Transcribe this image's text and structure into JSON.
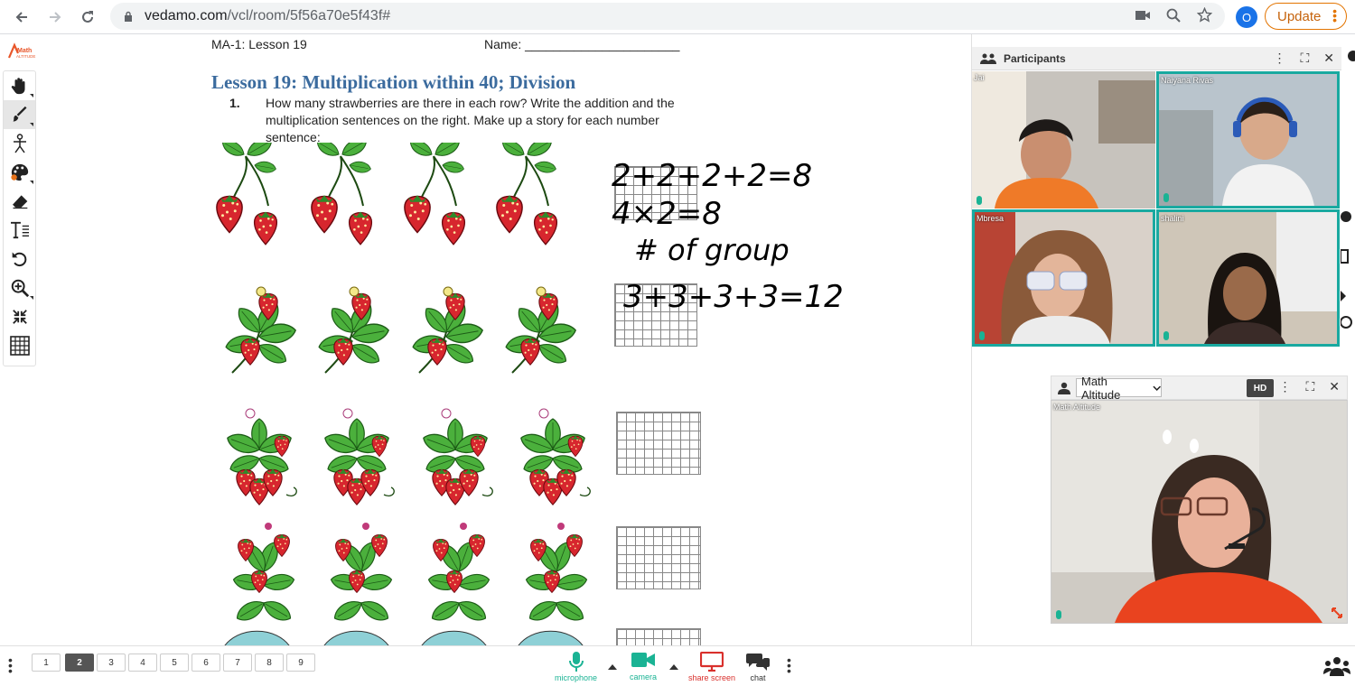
{
  "browser": {
    "url_host": "vedamo.com",
    "url_path": "/vcl/room/5f56a70e5f43f#",
    "profile_initial": "O",
    "update_label": "Update"
  },
  "app": {
    "logo_text": "Math Altitude",
    "tools": [
      "hand-icon",
      "brush-icon",
      "figure-icon",
      "palette-icon",
      "eraser-icon",
      "text-icon",
      "undo-icon",
      "zoom-icon",
      "fit-icon",
      "grid-icon"
    ]
  },
  "worksheet": {
    "header_left": "MA-1: Lesson 19",
    "header_right": "Name: ______________________",
    "lesson_title": "Lesson 19:   Multiplication within 40; Division",
    "question_number": "1.",
    "question_text": "How many strawberries are there in each row? Write the addition and the multiplication sentences on the right. Make up a story for each number sentence:",
    "handwriting": [
      "2+2+2+2=8",
      "4×2=8",
      "# of group",
      "3+3+3+3=12"
    ]
  },
  "participants": {
    "title": "Participants",
    "tiles": [
      {
        "name": "Jai"
      },
      {
        "name": "Naiyana Rivas"
      },
      {
        "name": "Mbresa"
      },
      {
        "name": "shalini"
      }
    ]
  },
  "teacher": {
    "select_value": "Math Altitude",
    "hd_label": "HD",
    "video_label": "Math Altitude"
  },
  "bottom": {
    "pages": [
      "1",
      "2",
      "3",
      "4",
      "5",
      "6",
      "7",
      "8",
      "9"
    ],
    "active_page": "2",
    "microphone_label": "microphone",
    "camera_label": "camera",
    "share_label": "share screen",
    "chat_label": "chat"
  },
  "colors": {
    "accent_teal": "#19a9a0",
    "title_blue": "#3b6b9e",
    "update_orange": "#e37400",
    "share_red": "#d9302c"
  }
}
